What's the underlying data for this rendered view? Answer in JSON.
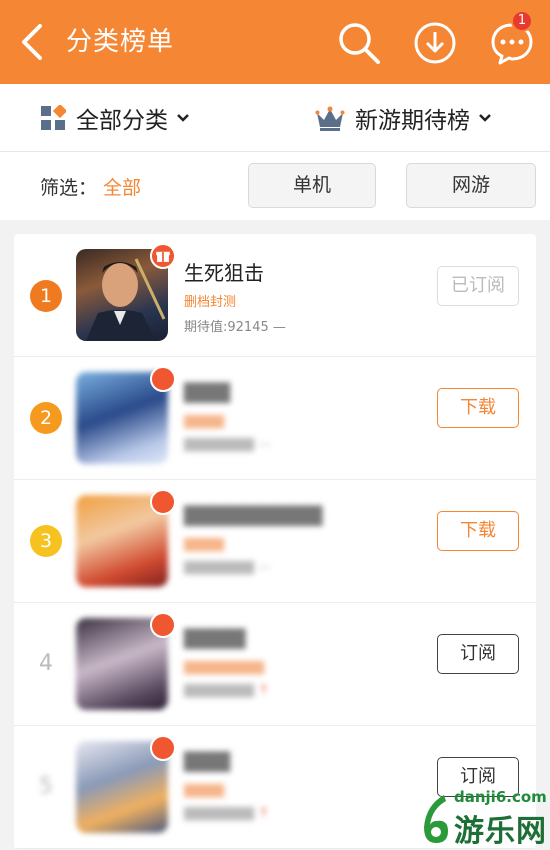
{
  "header": {
    "title": "分类榜单",
    "notification_count": "1"
  },
  "category_bar": {
    "left_label": "全部分类",
    "right_label": "新游期待榜"
  },
  "filter": {
    "label": "筛选：",
    "value": "全部",
    "options": [
      "单机",
      "网游"
    ]
  },
  "games": [
    {
      "rank": "1",
      "name": "生死狙击",
      "tag": "删档封测",
      "expect": "期待值:92145",
      "trend": "—",
      "button": "已订阅"
    },
    {
      "rank": "2",
      "name": "▇▇▇",
      "tag": "▇▇▇▇",
      "expect": "▇▇▇▇▇▇▇",
      "trend": "—",
      "button": "下载"
    },
    {
      "rank": "3",
      "name": "▇▇▇▇▇▇▇▇▇",
      "tag": "▇▇▇▇",
      "expect": "▇▇▇▇▇▇▇",
      "trend": "—",
      "button": "下载"
    },
    {
      "rank": "4",
      "name": "▇▇▇▇",
      "tag": "▇▇▇▇▇▇▇▇",
      "expect": "▇▇▇▇▇▇▇",
      "trend": "↑",
      "button": "订阅"
    },
    {
      "rank": "5",
      "name": "▇▇▇",
      "tag": "▇▇▇▇",
      "expect": "▇▇▇▇▇▇▇",
      "trend": "↑",
      "button": "订阅"
    }
  ],
  "watermark": {
    "domain": "danji6.com",
    "name": "游乐网"
  },
  "colors": {
    "brand": "#f58634",
    "rank1": "#f07a1f",
    "rank2": "#f59a1f",
    "rank3": "#f5c21f"
  }
}
